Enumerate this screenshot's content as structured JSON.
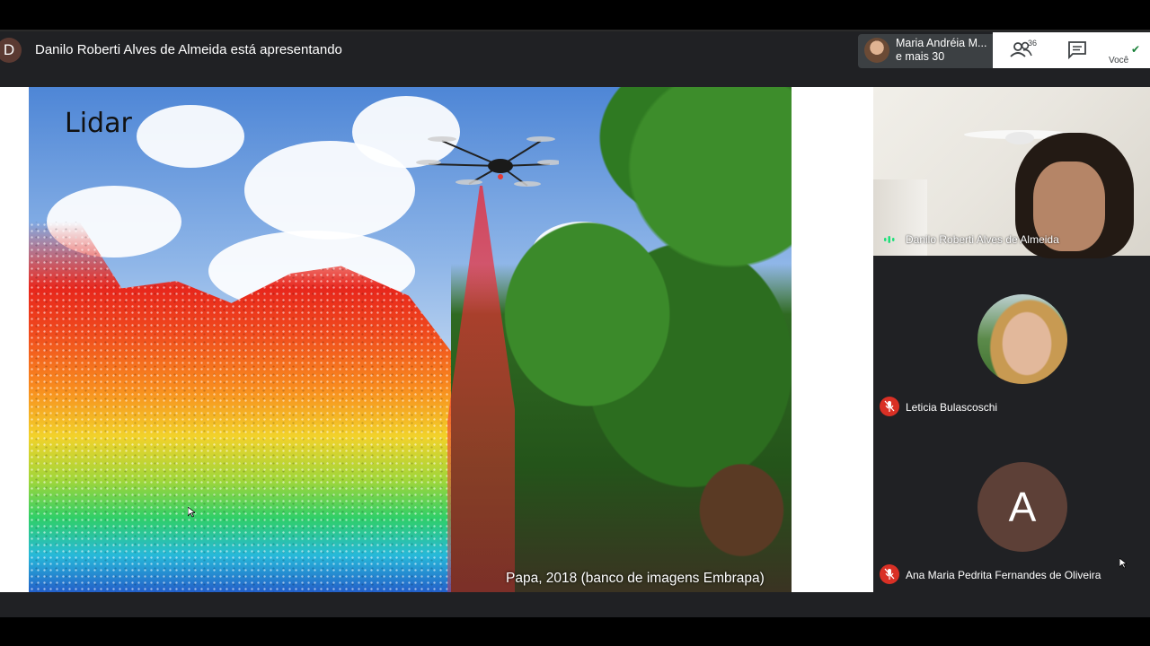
{
  "meeting": {
    "presenter_initial": "D",
    "presenting_text": "Danilo Roberti Alves de Almeida está apresentando"
  },
  "participants_chip": {
    "name": "Maria Andréia M...",
    "more": "e mais 30"
  },
  "controls": {
    "people_count": "36",
    "you_label": "Você"
  },
  "slide": {
    "title": "Lidar",
    "caption": "Papa, 2018 (banco de imagens Embrapa)"
  },
  "tiles": [
    {
      "name": "Danilo Roberti Alves de Almeida",
      "state": "speaking"
    },
    {
      "name": "Leticia Bulascoschi",
      "state": "muted"
    },
    {
      "name": "Ana Maria Pedrita Fernandes de Oliveira",
      "initial": "A",
      "state": "muted"
    }
  ],
  "colors": {
    "header_bg": "#202124",
    "muted_red": "#d93025",
    "avatar_brown": "#5d4037"
  }
}
